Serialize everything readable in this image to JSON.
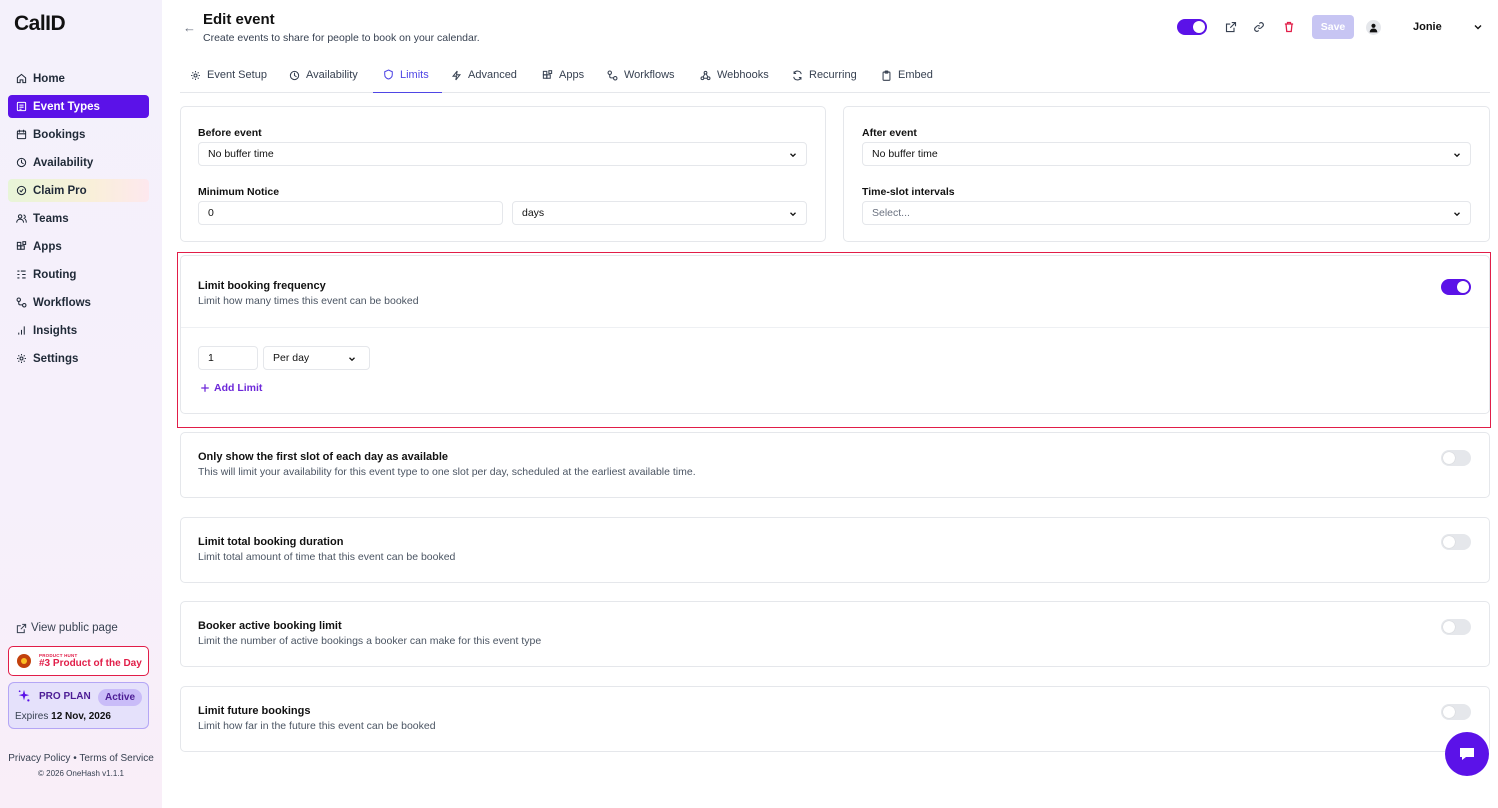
{
  "brand": {
    "logo": "CalID"
  },
  "sidebar": {
    "items": [
      {
        "label": "Home",
        "icon": "home-icon"
      },
      {
        "label": "Event Types",
        "icon": "event-types-icon",
        "active": true
      },
      {
        "label": "Bookings",
        "icon": "calendar-icon"
      },
      {
        "label": "Availability",
        "icon": "clock-icon"
      },
      {
        "label": "Claim Pro",
        "icon": "badge-icon"
      },
      {
        "label": "Teams",
        "icon": "users-icon"
      },
      {
        "label": "Apps",
        "icon": "apps-icon"
      },
      {
        "label": "Routing",
        "icon": "routing-icon"
      },
      {
        "label": "Workflows",
        "icon": "workflow-icon"
      },
      {
        "label": "Insights",
        "icon": "bar-chart-icon"
      },
      {
        "label": "Settings",
        "icon": "gear-icon"
      }
    ],
    "view_public": "View public page",
    "product_hunt": {
      "small": "PRODUCT HUNT",
      "big": "#3 Product of the Day"
    },
    "plan": {
      "name": "PRO PLAN",
      "status": "Active",
      "expires_label": "Expires",
      "expires_date": "12 Nov, 2026"
    },
    "footer": {
      "privacy": "Privacy Policy",
      "separator": "•",
      "terms": "Terms of Service",
      "copyright": "© 2026 OneHash v1.1.1"
    }
  },
  "header": {
    "back": "←",
    "title": "Edit event",
    "subtitle": "Create events to share for people to book on your calendar.",
    "save_label": "Save",
    "user_name": "Jonie",
    "hidden_toggle_on": true
  },
  "tabs": [
    {
      "label": "Event Setup",
      "icon": "gear-icon"
    },
    {
      "label": "Availability",
      "icon": "clock-icon"
    },
    {
      "label": "Limits",
      "icon": "shield-icon",
      "active": true
    },
    {
      "label": "Advanced",
      "icon": "bolt-icon"
    },
    {
      "label": "Apps",
      "icon": "apps-icon"
    },
    {
      "label": "Workflows",
      "icon": "workflow-icon"
    },
    {
      "label": "Webhooks",
      "icon": "webhook-icon"
    },
    {
      "label": "Recurring",
      "icon": "refresh-icon"
    },
    {
      "label": "Embed",
      "icon": "clipboard-icon"
    }
  ],
  "buffers": {
    "before_label": "Before event",
    "before_value": "No buffer time",
    "after_label": "After event",
    "after_value": "No buffer time",
    "min_notice_label": "Minimum Notice",
    "min_notice_value": "0",
    "min_notice_unit": "days",
    "slot_interval_label": "Time-slot intervals",
    "slot_interval_placeholder": "Select..."
  },
  "limits": {
    "frequency": {
      "title": "Limit booking frequency",
      "desc": "Limit how many times this event can be booked",
      "enabled": true,
      "count": "1",
      "period": "Per day",
      "add_label": "Add Limit"
    },
    "first_slot": {
      "title": "Only show the first slot of each day as available",
      "desc": "This will limit your availability for this event type to one slot per day, scheduled at the earliest available time.",
      "enabled": false
    },
    "duration": {
      "title": "Limit total booking duration",
      "desc": "Limit total amount of time that this event can be booked",
      "enabled": false
    },
    "booker_active": {
      "title": "Booker active booking limit",
      "desc": "Limit the number of active bookings a booker can make for this event type",
      "enabled": false
    },
    "future": {
      "title": "Limit future bookings",
      "desc": "Limit how far in the future this event can be booked",
      "enabled": false
    }
  },
  "colors": {
    "accent": "#5b12e8",
    "highlight": "#e11d48",
    "tab_active": "#4f46e5"
  }
}
